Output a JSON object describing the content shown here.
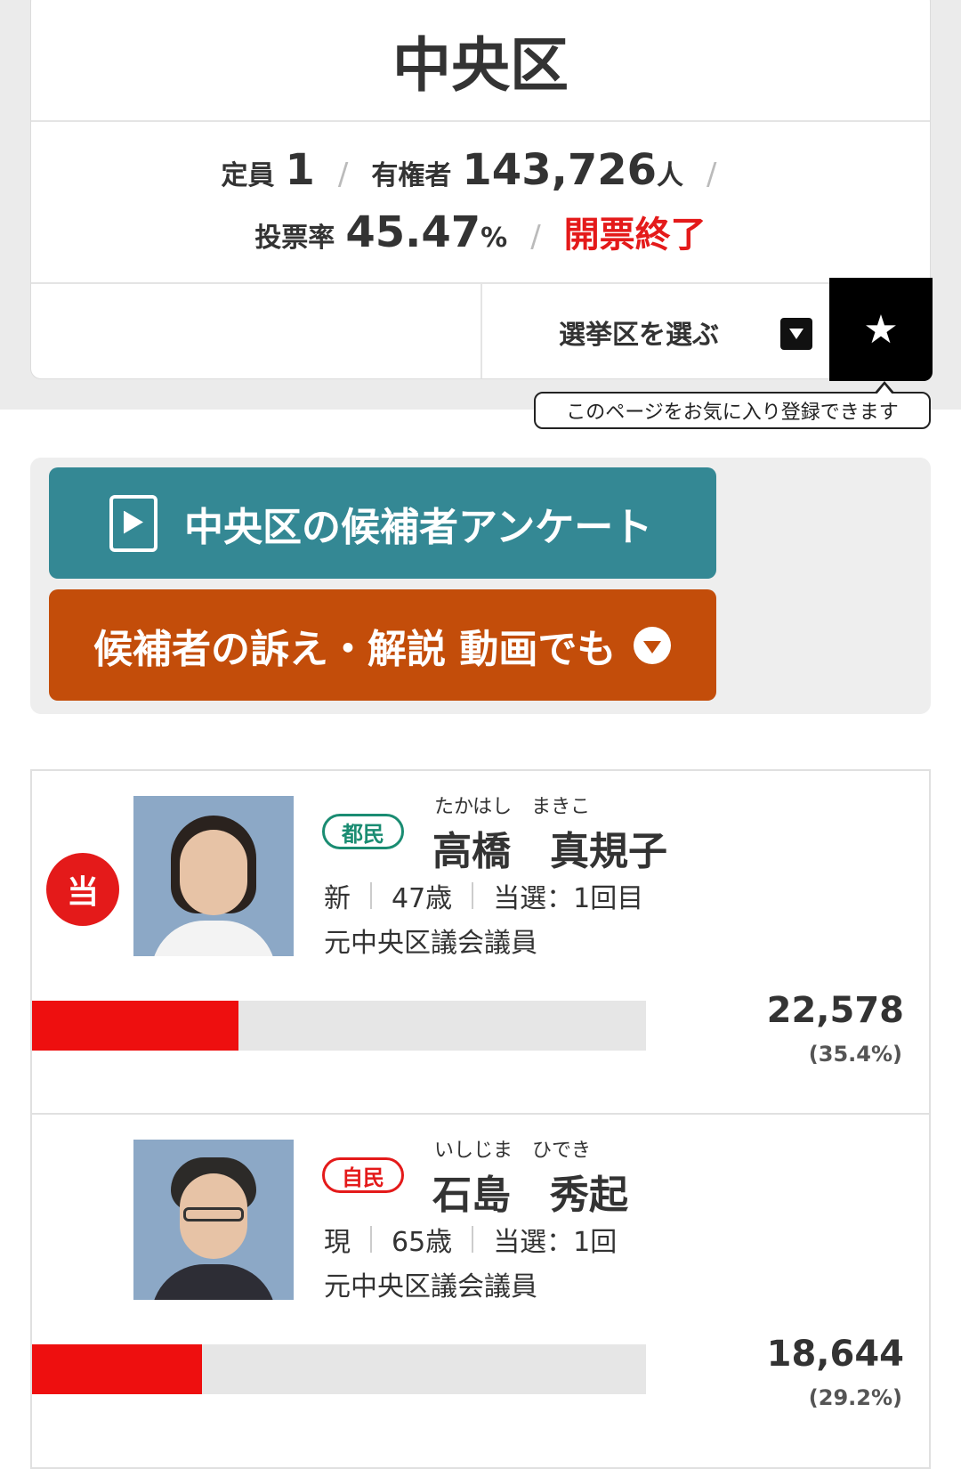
{
  "district": {
    "title": "中央区",
    "seats_label": "定員",
    "seats_value": "1",
    "voters_label": "有権者",
    "voters_value": "143,726",
    "voters_unit": "人",
    "turnout_label": "投票率",
    "turnout_value": "45.47",
    "turnout_unit": "%",
    "status": "開票終了",
    "separator": "/"
  },
  "selector": {
    "label": "選挙区を選ぶ",
    "favorite_icon": "★",
    "tooltip": "このページをお気に入り登録できます"
  },
  "links": {
    "survey_label": "中央区の候補者アンケート",
    "video_label": "候補者の訴え・解説 動画でも"
  },
  "candidates": [
    {
      "win_mark": "当",
      "party": "都民",
      "furigana": "たかはし　まきこ",
      "name": "高橋　真規子",
      "status": "新",
      "age": "47歳",
      "elected": "当選：1回目",
      "career": "元中央区議会議員",
      "votes": "22,578",
      "percent": "(35.4%)",
      "share": 0.354
    },
    {
      "party": "自民",
      "furigana": "いしじま　ひでき",
      "name": "石島　秀起",
      "status": "現",
      "age": "65歳",
      "elected": "当選：1回",
      "career": "元中央区議会議員",
      "votes": "18,644",
      "percent": "(29.2%)",
      "share": 0.292
    }
  ],
  "colors": {
    "accent_red": "#e41a1a",
    "survey_teal": "#348894",
    "video_orange": "#c34d0a",
    "bar_red": "#ee0f0f"
  }
}
